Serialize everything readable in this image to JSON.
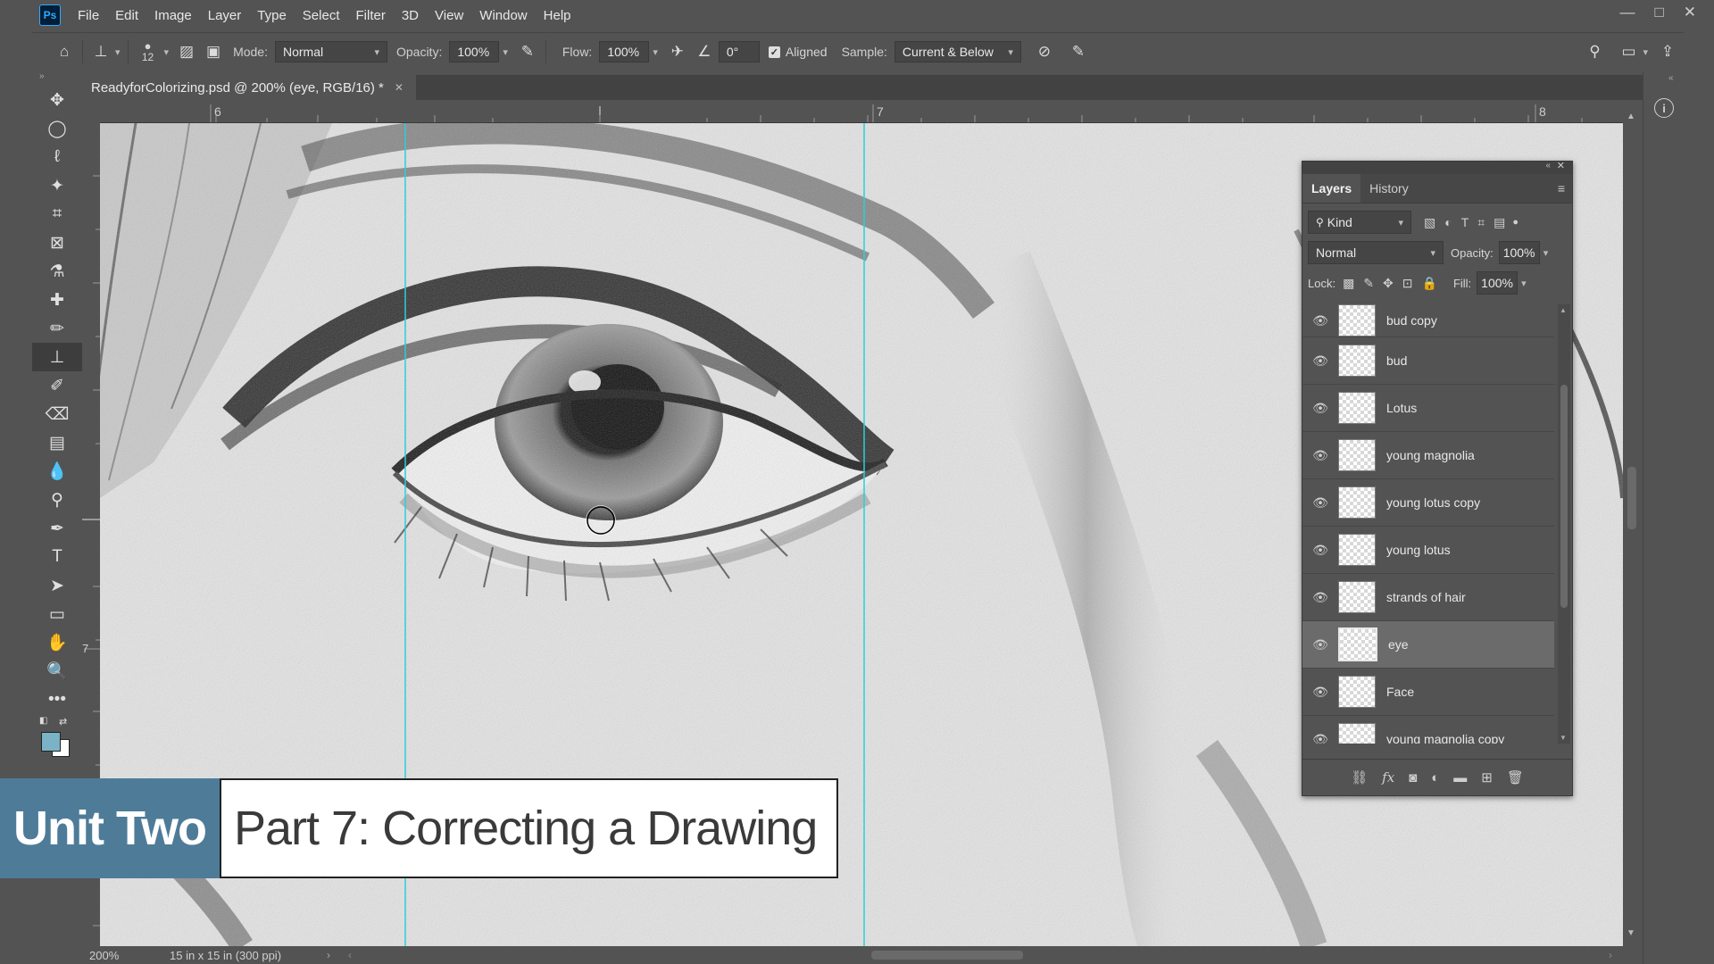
{
  "app": {
    "logo": "Ps"
  },
  "menu": [
    "File",
    "Edit",
    "Image",
    "Layer",
    "Type",
    "Select",
    "Filter",
    "3D",
    "View",
    "Window",
    "Help"
  ],
  "window_controls": {
    "minimize": "—",
    "restore": "□",
    "close": "✕"
  },
  "options": {
    "brush_size": "12",
    "mode_label": "Mode:",
    "mode_value": "Normal",
    "opacity_label": "Opacity:",
    "opacity_value": "100%",
    "flow_label": "Flow:",
    "flow_value": "100%",
    "angle_value": "0°",
    "aligned_label": "Aligned",
    "sample_label": "Sample:",
    "sample_value": "Current & Below"
  },
  "document": {
    "tab_title": "ReadyforColorizing.psd @ 200% (eye, RGB/16) *",
    "ruler_marks": [
      "6",
      "7",
      "8"
    ],
    "vruler_mark": "7"
  },
  "status": {
    "zoom": "200%",
    "doc_size": "15 in x 15 in (300 ppi)"
  },
  "layers_panel": {
    "tabs": [
      "Layers",
      "History"
    ],
    "filter_kind": "Kind",
    "blend_mode": "Normal",
    "opacity_label": "Opacity:",
    "opacity_value": "100%",
    "lock_label": "Lock:",
    "fill_label": "Fill:",
    "fill_value": "100%",
    "layers": [
      {
        "name": "bud copy",
        "selected": false
      },
      {
        "name": "bud",
        "selected": false
      },
      {
        "name": "Lotus",
        "selected": false
      },
      {
        "name": "young magnolia",
        "selected": false
      },
      {
        "name": "young lotus copy",
        "selected": false
      },
      {
        "name": "young lotus",
        "selected": false
      },
      {
        "name": "strands of hair",
        "selected": false
      },
      {
        "name": "eye",
        "selected": true
      },
      {
        "name": "Face",
        "selected": false
      },
      {
        "name": "young magnolia copy",
        "selected": false
      }
    ]
  },
  "banner": {
    "unit": "Unit Two",
    "part": "Part 7: Correcting a Drawing"
  },
  "colors": {
    "banner_blue": "#4e7c98",
    "guide": "#2ad0d8",
    "swatch_fg": "#7ab3c6"
  }
}
